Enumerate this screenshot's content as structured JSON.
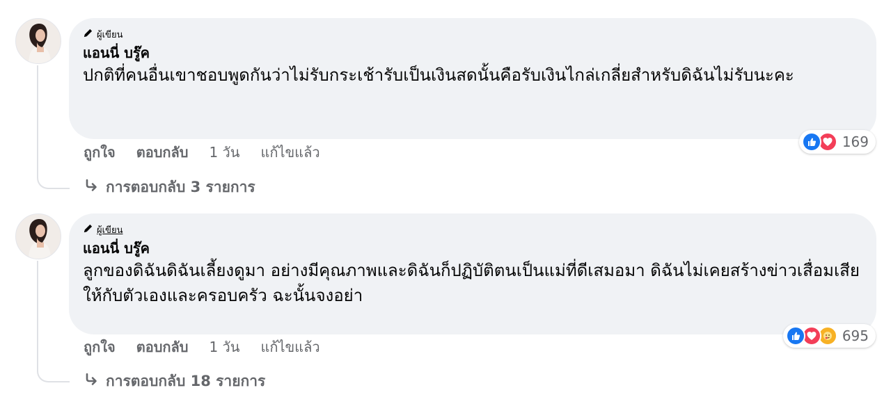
{
  "comments": [
    {
      "badge": "ผู้เขียน",
      "author": "แอนนี่ บรู๊ค",
      "text": "ปกติที่คนอื่นเขาชอบพูดกันว่าไม่รับกระเช้ารับเป็นเงินสดนั้นคือรับเงินไกล่เกลี่ยสำหรับดิฉันไม่รับนะคะ",
      "reaction_count": "169",
      "reactions": [
        "like-icon",
        "love-icon"
      ],
      "like_label": "ถูกใจ",
      "reply_label": "ตอบกลับ",
      "time": "1 วัน",
      "edited": "แก้ไขแล้ว",
      "replies_label": "การตอบกลับ 3 รายการ"
    },
    {
      "badge": "ผู้เขียน",
      "author": "แอนนี่ บรู๊ค",
      "text": "ลูกของดิฉันดิฉันเลี้ยงดูมา อย่างมีคุณภาพและดิฉันก็ปฏิบัติตนเป็นแม่ที่ดีเสมอมา ดิฉันไม่เคยสร้างข่าวเสื่อมเสียให้กับตัวเองและครอบครัว ฉะนั้นจงอย่า",
      "reaction_count": "695",
      "reactions": [
        "like-icon",
        "love-icon",
        "care-icon"
      ],
      "like_label": "ถูกใจ",
      "reply_label": "ตอบกลับ",
      "time": "1 วัน",
      "edited": "แก้ไขแล้ว",
      "replies_label": "การตอบกลับ 18 รายการ"
    }
  ],
  "colors": {
    "bubble": "#f0f2f5",
    "meta_text": "#65676b",
    "like": "#1877f2",
    "love": "#f33e58",
    "care": "#f7b125"
  }
}
